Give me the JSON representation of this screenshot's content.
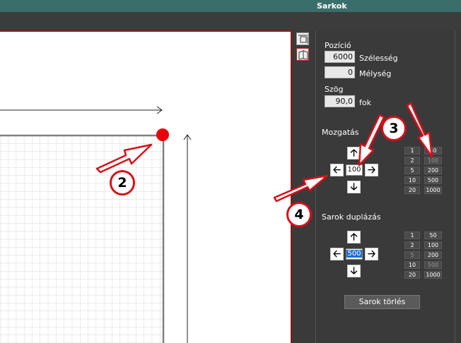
{
  "window": {
    "title": "Sarkok"
  },
  "panel": {
    "position_label": "Pozíció",
    "width_value": "6000",
    "width_label": "Szélesség",
    "depth_value": "0",
    "depth_label": "Mélység",
    "angle_label": "Szög",
    "angle_value": "90,0",
    "angle_unit": "fok",
    "move_label": "Mozgatás",
    "move_step": "100",
    "duplicate_label": "Sarok duplázás",
    "duplicate_step": "500",
    "delete_button": "Sarok törlés"
  },
  "move_steps": [
    "1",
    "50",
    "2",
    "100",
    "5",
    "200",
    "10",
    "500",
    "20",
    "1000"
  ],
  "duplicate_steps": [
    "1",
    "50",
    "2",
    "100",
    "5",
    "200",
    "10",
    "500",
    "20",
    "1000"
  ],
  "arrows": {
    "up": "🡡",
    "down": "🡣",
    "left": "🡠",
    "right": "🡢"
  },
  "annotations": {
    "badge_2": "2",
    "badge_3": "3",
    "badge_4": "4"
  },
  "colors": {
    "title_bar": "#3a6e6a",
    "annotation_red": "#d6101a",
    "corner_marker": "#e8000d",
    "selection": "#1f6fd1"
  }
}
